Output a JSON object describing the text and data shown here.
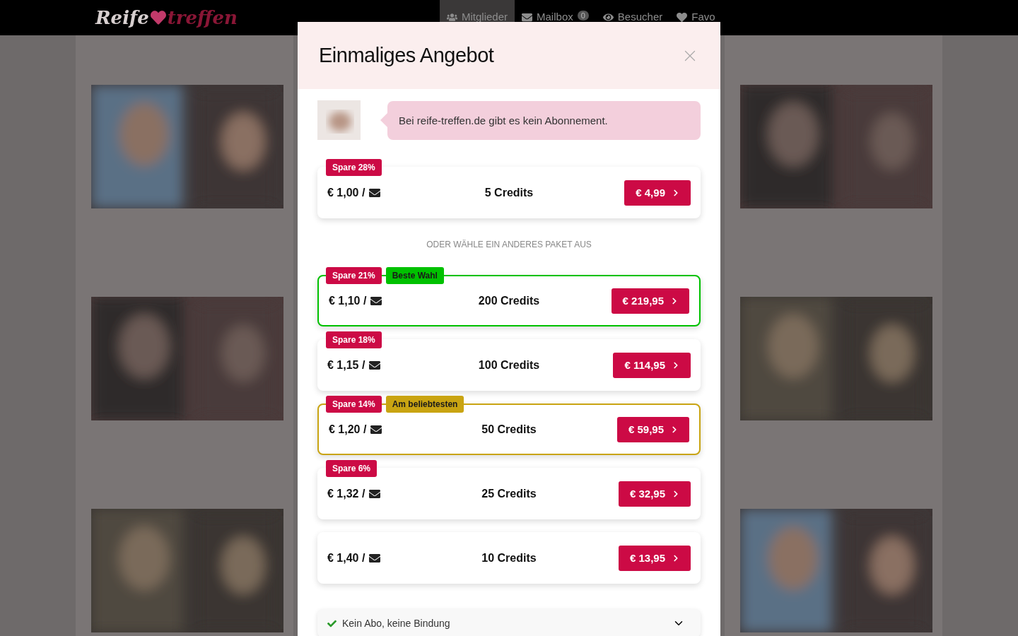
{
  "header": {
    "logo": {
      "left": "Reife",
      "right": "treffen"
    },
    "nav": [
      {
        "label": "Mitglieder",
        "selected": true
      },
      {
        "label": "Mailbox",
        "count": "0",
        "selected": false
      },
      {
        "label": "Besucher",
        "selected": false
      },
      {
        "label": "Favo",
        "selected": false
      }
    ]
  },
  "modal": {
    "title": "Einmaliges Angebot",
    "message": "Bei reife-treffen.de gibt es kein Abonnement.",
    "featured": {
      "savings": "Spare 28%",
      "per_message": "€ 1,00 /",
      "credits": "5 Credits",
      "price": "€ 4,99"
    },
    "divider_text": "ODER WÄHLE EIN ANDERES PAKET AUS",
    "packages": [
      {
        "savings": "Spare 21%",
        "tag": {
          "label": "Beste Wahl",
          "color": "#00c100"
        },
        "per_message": "€ 1,10 /",
        "credits": "200 Credits",
        "price": "€ 219,95"
      },
      {
        "savings": "Spare 18%",
        "per_message": "€ 1,15 /",
        "credits": "100 Credits",
        "price": "€ 114,95"
      },
      {
        "savings": "Spare 14%",
        "tag": {
          "label": "Am beliebtesten",
          "color": "#c9a412"
        },
        "per_message": "€ 1,20 /",
        "credits": "50 Credits",
        "price": "€ 59,95"
      },
      {
        "savings": "Spare 6%",
        "per_message": "€ 1,32 /",
        "credits": "25 Credits",
        "price": "€ 32,95"
      },
      {
        "per_message": "€ 1,40 /",
        "credits": "10 Credits",
        "price": "€ 13,95"
      }
    ],
    "info": [
      {
        "label": "Kein Abo, keine Bindung",
        "expanded": false
      }
    ]
  }
}
